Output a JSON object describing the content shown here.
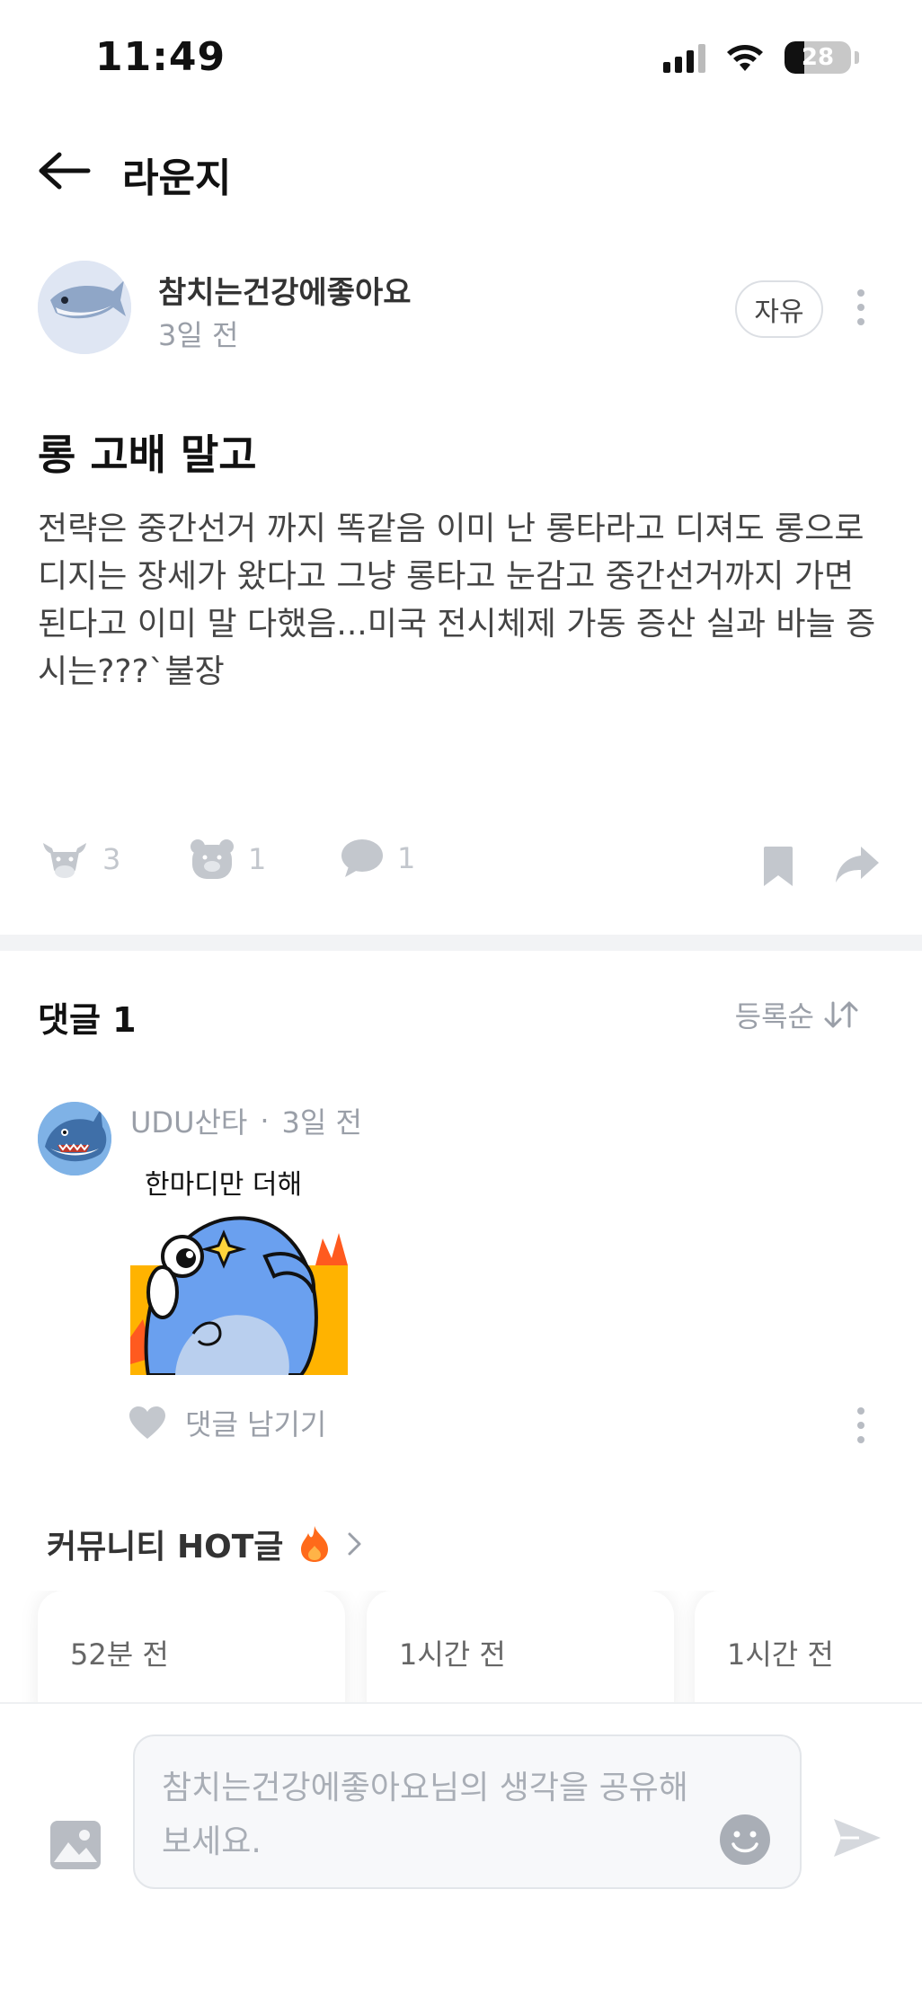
{
  "status_bar": {
    "time": "11:49",
    "battery": "28"
  },
  "header": {
    "title": "라운지",
    "back_icon": "arrow-left-icon"
  },
  "post": {
    "author": "참치는건강에좋아요",
    "time": "3일 전",
    "tag": "자유",
    "title": "롱 고배 말고",
    "body": "전략은 중간선거 까지 똑같음 이미 난 롱타라고 디져도 롱으로 디지는 장세가 왔다고 그냥 롱타고 눈감고 중간선거까지 가면 된다고 이미 말 다했음...미국 전시체제 가동 증산 실과 바늘 증시는???`불장",
    "reactions": {
      "bull": "3",
      "bear": "1",
      "comments": "1"
    }
  },
  "comments": {
    "label": "댓글 1",
    "sort": "등록순",
    "items": [
      {
        "author": "UDU산타",
        "separator": "·",
        "time": "3일 전",
        "sticker_text": "한마디만 더해",
        "reply_label": "댓글 남기기"
      }
    ]
  },
  "hot": {
    "title": "커뮤니티 HOT글",
    "cards": [
      {
        "time": "52분 전"
      },
      {
        "time": "1시간 전"
      },
      {
        "time": "1시간 전"
      }
    ]
  },
  "composer": {
    "placeholder": "참치는건강에좋아요님의 생각을 공유해 보세요."
  },
  "colors": {
    "accent_fire": "#ff6a1a",
    "muted": "#9a9fa8",
    "icon_gray": "#c3c7cd"
  }
}
